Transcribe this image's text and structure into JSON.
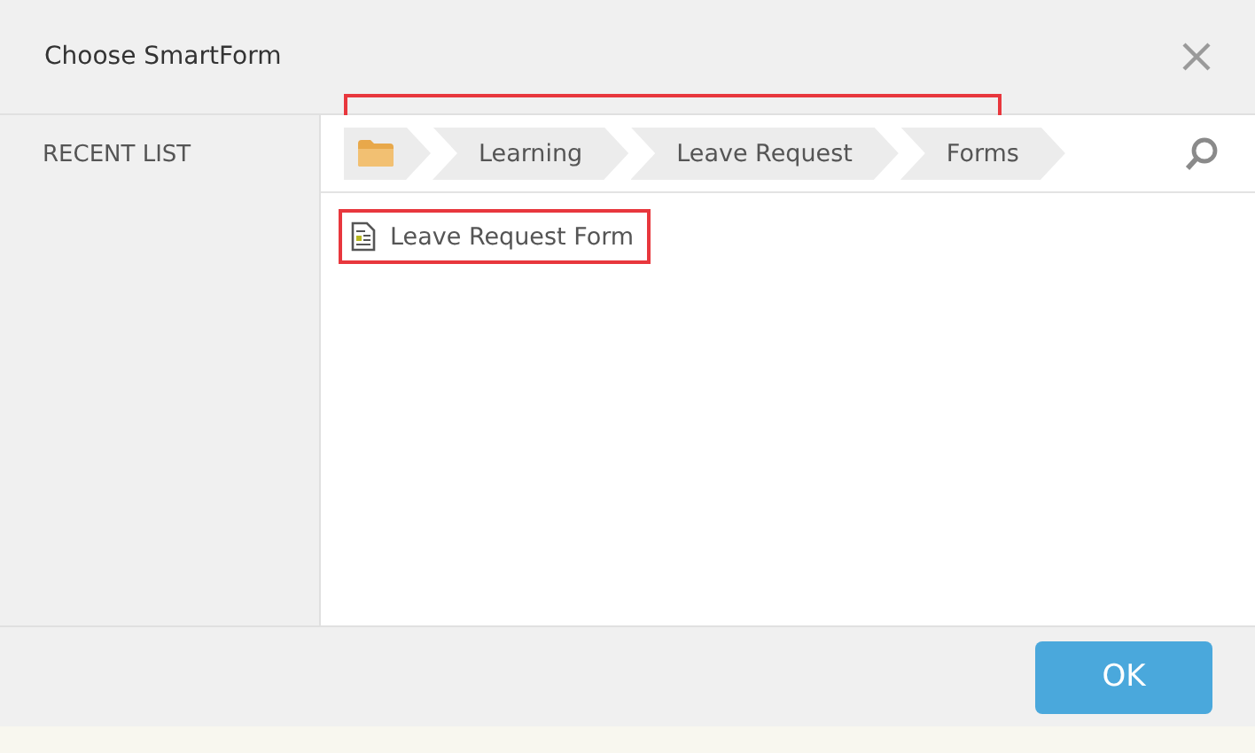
{
  "window": {
    "title": "Choose SmartForm"
  },
  "sidebar": {
    "items": [
      {
        "label": "RECENT LIST",
        "selected": false
      }
    ]
  },
  "breadcrumb": [
    {
      "label": "Learning"
    },
    {
      "label": "Leave Request"
    },
    {
      "label": "Forms"
    }
  ],
  "items": [
    {
      "label": "Leave Request Form",
      "highlighted": true
    }
  ],
  "buttons": [
    "OK"
  ]
}
